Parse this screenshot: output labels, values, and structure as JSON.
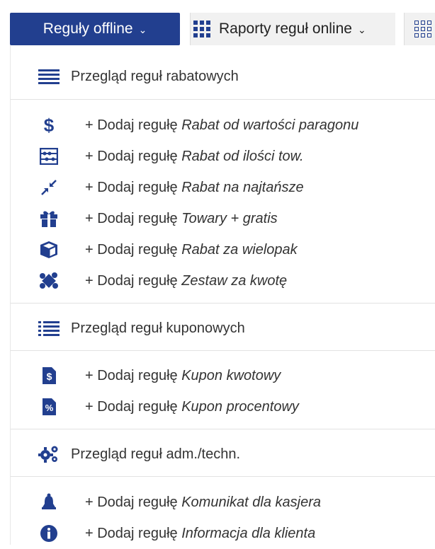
{
  "nav": {
    "active_tab": "Reguły offline",
    "tab2": "Raporty reguł online",
    "chevron": "⌄"
  },
  "menu": {
    "add_prefix": "+ Dodaj regułę",
    "discount_overview": "Przegląd reguł rabatowych",
    "discount_rules": [
      {
        "icon": "dollar-icon",
        "name": "Rabat od wartości paragonu"
      },
      {
        "icon": "abacus-icon",
        "name": "Rabat od ilości tow."
      },
      {
        "icon": "arrows-compress-icon",
        "name": "Rabat na najtańsze"
      },
      {
        "icon": "gift-icon",
        "name": "Towary + gratis"
      },
      {
        "icon": "box-icon",
        "name": "Rabat za wielopak"
      },
      {
        "icon": "puzzle-icon",
        "name": "Zestaw za kwotę"
      }
    ],
    "coupon_overview": "Przegląd reguł kuponowych",
    "coupon_rules": [
      {
        "icon": "coupon-amount-icon",
        "name": "Kupon kwotowy"
      },
      {
        "icon": "coupon-percent-icon",
        "name": "Kupon procentowy"
      }
    ],
    "admin_overview": "Przegląd reguł adm./techn.",
    "admin_rules": [
      {
        "icon": "bell-icon",
        "name": "Komunikat dla kasjera"
      },
      {
        "icon": "info-icon",
        "name": "Informacja dla klienta"
      }
    ]
  },
  "colors": {
    "accent": "#223f8f",
    "active_tab_text": "#ffffff",
    "divider": "#e2e2e2"
  }
}
